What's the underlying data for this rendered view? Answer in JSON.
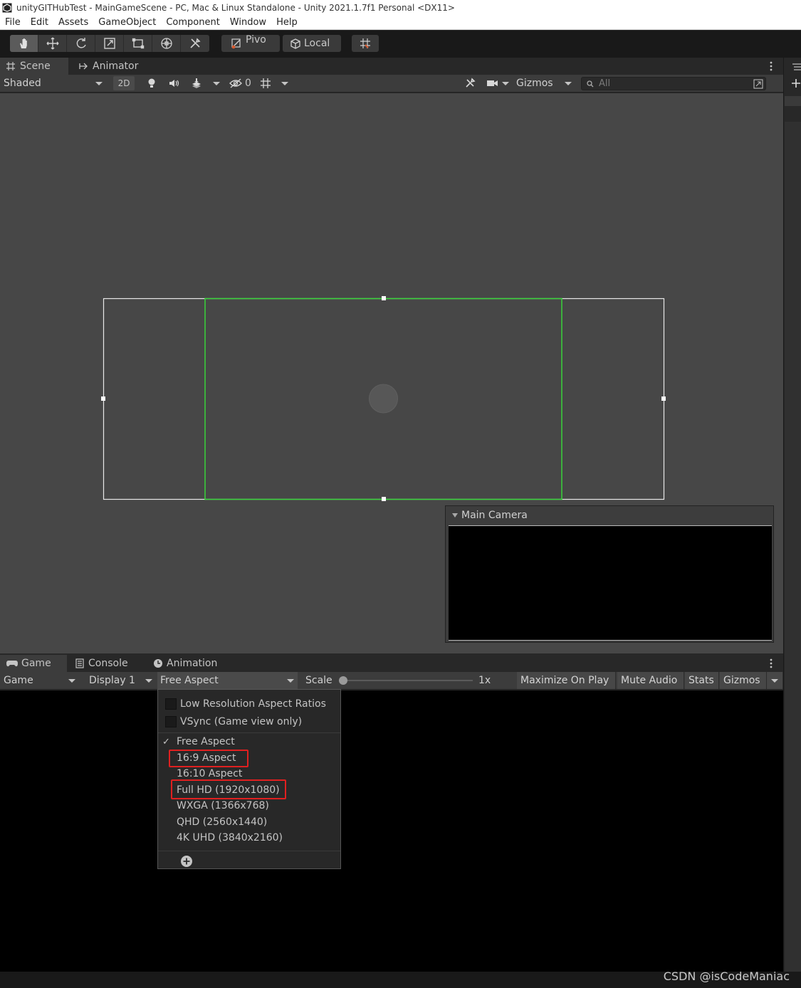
{
  "window": {
    "title": "unityGITHubTest - MainGameScene - PC, Mac & Linux Standalone - Unity 2021.1.7f1 Personal <DX11>"
  },
  "menubar": [
    "File",
    "Edit",
    "Assets",
    "GameObject",
    "Component",
    "Window",
    "Help"
  ],
  "toolbar": {
    "tools": [
      "hand-tool-icon",
      "move-tool-icon",
      "rotate-tool-icon",
      "scale-tool-icon",
      "rect-tool-icon",
      "transform-tool-icon",
      "custom-tool-icon"
    ],
    "pivot_label": "Pivo",
    "local_label": "Local"
  },
  "scene_panel": {
    "tabs": [
      "Scene",
      "Animator"
    ],
    "shading_mode": "Shaded",
    "mode_2d_label": "2D",
    "hidden_count": "0",
    "gizmos_label": "Gizmos",
    "search_placeholder": "All"
  },
  "camera_preview": {
    "title": "Main Camera"
  },
  "game_panel": {
    "tabs": [
      "Game",
      "Console",
      "Animation"
    ],
    "view_mode": "Game",
    "display": "Display 1",
    "aspect": "Free Aspect",
    "scale_label": "Scale",
    "scale_value": "1x",
    "buttons": [
      "Maximize On Play",
      "Mute Audio",
      "Stats",
      "Gizmos"
    ]
  },
  "aspect_menu": {
    "checkboxes": [
      "Low Resolution Aspect Ratios",
      "VSync (Game view only)"
    ],
    "items": [
      {
        "label": "Free Aspect",
        "checked": true,
        "highlighted": false
      },
      {
        "label": "16:9 Aspect",
        "checked": false,
        "highlighted": true
      },
      {
        "label": "16:10 Aspect",
        "checked": false,
        "highlighted": false
      },
      {
        "label": "Full HD (1920x1080)",
        "checked": false,
        "highlighted": true
      },
      {
        "label": "WXGA (1366x768)",
        "checked": false,
        "highlighted": false
      },
      {
        "label": "QHD (2560x1440)",
        "checked": false,
        "highlighted": false
      },
      {
        "label": "4K UHD (3840x2160)",
        "checked": false,
        "highlighted": false
      }
    ],
    "check_mark": "✓"
  },
  "watermark": "CSDN @isCodeManiac",
  "colors": {
    "highlight_box": "#e02020",
    "camera_frame_green": "#39d43a",
    "gizmo_outline": "#ffffff"
  }
}
